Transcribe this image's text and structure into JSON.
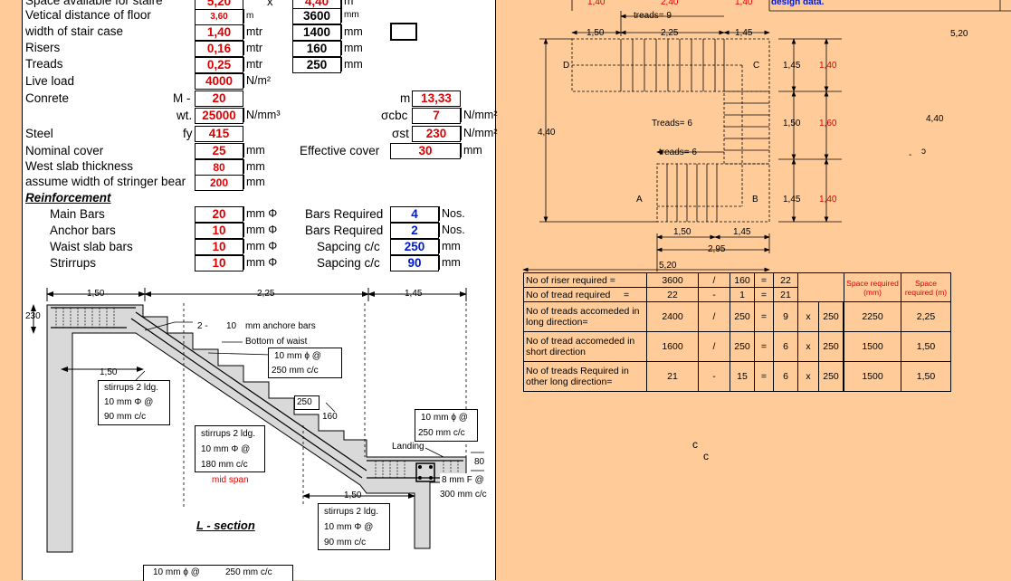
{
  "inputs": {
    "space_available": {
      "label": "Space available for staire",
      "v1": "5,20",
      "x": "x",
      "v2": "4,40",
      "unit": "m"
    },
    "vertical_distance": {
      "label": "Vetical distance of floor",
      "v1": "3,60",
      "u1": "m",
      "v2": "3600",
      "u2": "mm"
    },
    "width_stair": {
      "label": "width of stair case",
      "v1": "1,40",
      "u1": "mtr",
      "v2": "1400",
      "u2": "mm"
    },
    "risers": {
      "label": "Risers",
      "v1": "0,16",
      "u1": "mtr",
      "v2": "160",
      "u2": "mm"
    },
    "treads": {
      "label": "Treads",
      "v1": "0,25",
      "u1": "mtr",
      "v2": "250",
      "u2": "mm"
    },
    "live_load": {
      "label": "Live load",
      "v1": "4000",
      "u1": "N/m²"
    },
    "concrete": {
      "label": "Conrete",
      "m_label": "M -",
      "m_value": "20",
      "m2_label": "m",
      "m2_value": "13,33"
    },
    "weight": {
      "label": "wt.",
      "value": "25000",
      "unit": "N/mm³",
      "scbc_label": "σcbc",
      "scbc_value": "7",
      "scbc_unit": "N/mm²"
    },
    "steel": {
      "label": "Steel",
      "fy_label": "fy",
      "fy_value": "415",
      "sst_label": "σst",
      "sst_value": "230",
      "sst_unit": "N/mm²"
    },
    "nominal_cover": {
      "label": "Nominal cover",
      "value": "25",
      "unit": "mm",
      "eff_label": "Effective cover",
      "eff_value": "30",
      "eff_unit": "mm"
    },
    "waist_slab": {
      "label": "West slab thickness",
      "value": "80",
      "unit": "mm"
    },
    "stringer": {
      "label": "assume width of stringer bear",
      "value": "200",
      "unit": "mm"
    }
  },
  "reinforcement": {
    "title": "Reinforcement",
    "rows": [
      {
        "label": "Main Bars",
        "value": "20",
        "unit": "mm Φ",
        "right_label": "Bars Required",
        "right_value": "4",
        "right_unit": "Nos."
      },
      {
        "label": "Anchor bars",
        "value": "10",
        "unit": "mm Φ",
        "right_label": "Bars Required",
        "right_value": "2",
        "right_unit": "Nos."
      },
      {
        "label": "Waist slab bars",
        "value": "10",
        "unit": "mm Φ",
        "right_label": "Sapcing  c/c",
        "right_value": "250",
        "right_unit": "mm"
      },
      {
        "label": "Strirrups",
        "value": "10",
        "unit": "mm Φ",
        "right_label": "Sapcing  c/c",
        "right_value": "90",
        "right_unit": "mm"
      }
    ]
  },
  "section": {
    "title": "L - section",
    "dims": {
      "d1": "1,50",
      "d2": "2,25",
      "d3": "1,45",
      "d4": "1,50",
      "d5": "1,50",
      "h230": "230",
      "t250": "250",
      "r160": "160",
      "s80": "80"
    },
    "anchor_note": {
      "n": "2 -",
      "size": "10",
      "text": "mm anchore bars"
    },
    "bottom_waist": "Bottom of waist",
    "box_waist": {
      "l1": "10   mm ϕ @",
      "l2": "250  mm c/c"
    },
    "box_stirrups_left": {
      "l1": "stirrups 2 ldg.",
      "l2": "10   mm Φ @",
      "l3": "90   mm c/c"
    },
    "box_stirrups_mid": {
      "l1": "stirrups 2 ldg.",
      "l2": "10   mm Φ @",
      "l3": "180  mm c/c"
    },
    "mid_span": "mid span",
    "box_landing": {
      "l1": "10   mm ϕ @",
      "l2": "250  mm c/c"
    },
    "landing": "Landing",
    "landing_bar": {
      "l1": "8 mm F @",
      "l2": "300 mm c/c"
    },
    "box_stirrups_bottom": {
      "l1": "stirrups 2 ldg.",
      "l2": "10   mm Φ @",
      "l3": "90   mm c/c"
    },
    "bottom_box": {
      "l1": "10   mm ϕ @",
      "l2": "250  mm c/c"
    }
  },
  "plan": {
    "top": {
      "a": "1,40",
      "b": "2,40",
      "c": "1,40",
      "note": "design data."
    },
    "treads_top": "treads=   9",
    "dims_top": {
      "a": "1,50",
      "b": "2,25",
      "c": "1,45"
    },
    "corner_D": "D",
    "corner_C": "C",
    "corner_A": "A",
    "corner_B": "B",
    "treads_mid": "Treads=     6",
    "treads_low": "treads=  6",
    "left_height": "4,40",
    "right_col": [
      {
        "a": "1,45",
        "b": "1,40"
      },
      {
        "a": "1,50",
        "b": "1,60"
      },
      {
        "a": "1,45",
        "b": "1,40"
      }
    ],
    "bottom_dims": {
      "a": "1,50",
      "b": "1,45",
      "c": "2,95",
      "d": "5,20"
    },
    "side_520": "5,20",
    "side_440": "4,40",
    "glyph": "ɔ",
    "dash": "-",
    "c1": "c",
    "c2": "c"
  },
  "table": {
    "headers": {
      "space_mm": "Space required (mm)",
      "space_m": "Space required (m)"
    },
    "row1": {
      "label": "No of riser required =",
      "a": "3600",
      "op": "/",
      "b": "160",
      "eq": "=",
      "res": "22"
    },
    "row2": {
      "label": "No of tread required",
      "eq0": "=",
      "a": "22",
      "op": "-",
      "b": "1",
      "eq": "=",
      "res": "21"
    },
    "row3": {
      "label": "No of treads  accomeded in long direction=",
      "a": "2400",
      "op": "/",
      "b": "250",
      "eq": "=",
      "n": "9",
      "x": "x",
      "w": "250",
      "mm": "2250",
      "m": "2,25"
    },
    "row4": {
      "label": "No of tread accomeded in short direction",
      "a": "1600",
      "op": "/",
      "b": "250",
      "eq": "=",
      "n": "6",
      "x": "x",
      "w": "250",
      "mm": "1500",
      "m": "1,50"
    },
    "row5": {
      "label": "No of treads  Required  in other long direction=",
      "a": "21",
      "op": "-",
      "b": "15",
      "eq": "=",
      "n": "6",
      "x": "x",
      "w": "250",
      "mm": "1500",
      "m": "1,50"
    }
  }
}
